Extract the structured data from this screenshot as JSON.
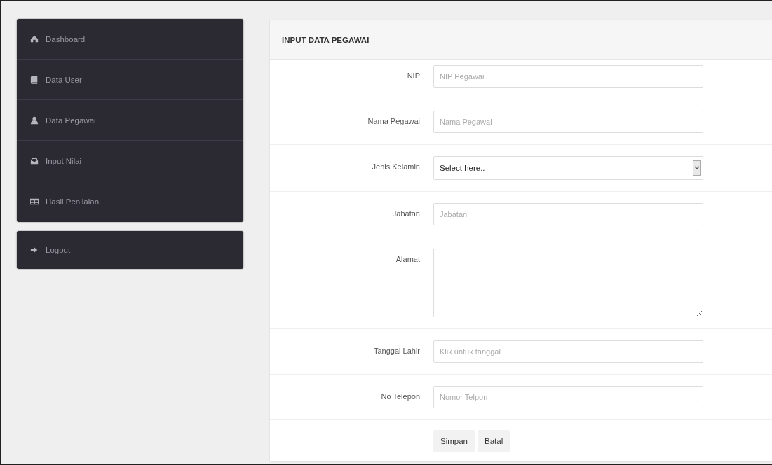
{
  "sidebar": {
    "items": [
      {
        "label": "Dashboard",
        "selected": false
      },
      {
        "label": "Data User",
        "selected": false
      },
      {
        "label": "Data Pegawai",
        "selected": false
      },
      {
        "label": "Input Nilai",
        "selected": false
      },
      {
        "label": "Hasil Penilaian",
        "selected": false
      }
    ],
    "logout": {
      "label": "Logout"
    }
  },
  "panel": {
    "title": "INPUT DATA PEGAWAI",
    "fields": [
      {
        "kind": "input",
        "label": "NIP",
        "placeholder": "NIP Pegawai"
      },
      {
        "kind": "input",
        "label": "Nama Pegawai",
        "placeholder": "Nama Pegawai"
      },
      {
        "kind": "select",
        "label": "Jenis Kelamin",
        "value": "Select here.."
      },
      {
        "kind": "input",
        "label": "Jabatan",
        "placeholder": "Jabatan"
      },
      {
        "kind": "textarea",
        "label": "Alamat"
      },
      {
        "kind": "input",
        "label": "Tanggal Lahir",
        "placeholder": "Klik untuk tanggal"
      },
      {
        "kind": "input",
        "label": "No Telepon",
        "placeholder": "Nomor Telpon"
      }
    ],
    "buttons": [
      "Simpan",
      "Batal"
    ]
  }
}
